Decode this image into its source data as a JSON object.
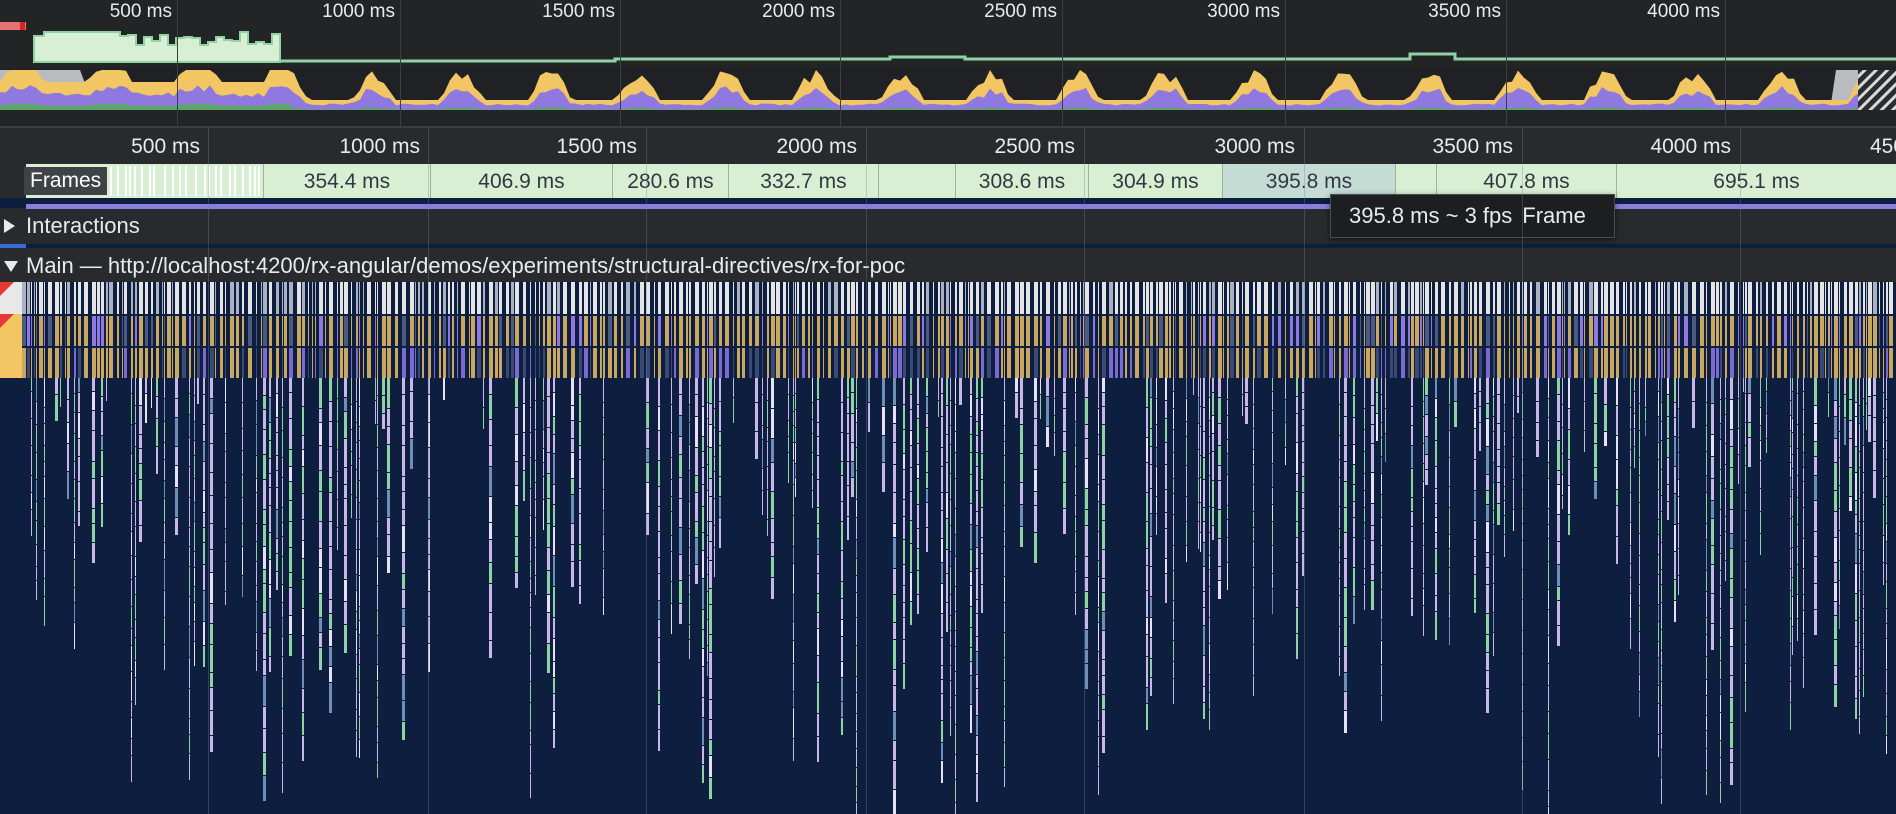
{
  "overview": {
    "ticks": [
      "500 ms",
      "1000 ms",
      "1500 ms",
      "2000 ms",
      "2500 ms",
      "3000 ms",
      "3500 ms",
      "4000 ms"
    ]
  },
  "timeline": {
    "ticks": [
      "500 ms",
      "1000 ms",
      "1500 ms",
      "2000 ms",
      "2500 ms",
      "3000 ms",
      "3500 ms",
      "4000 ms",
      "450"
    ]
  },
  "frames": {
    "label": "Frames",
    "durations": [
      "354.4 ms",
      "406.9 ms",
      "280.6 ms",
      "332.7 ms",
      "",
      "308.6 ms",
      "304.9 ms",
      "395.8 ms",
      "",
      "407.8 ms",
      "695.1 ms"
    ],
    "selected_index": 7
  },
  "tracks": {
    "interactions_label": "Interactions",
    "main_label": "Main — http://localhost:4200/rx-angular/demos/experiments/structural-directives/rx-for-poc"
  },
  "tooltip": {
    "duration": "395.8 ms ~ 3 fps",
    "type": "Frame"
  },
  "colors": {
    "flame_background": "#0d1e3e",
    "scripting": "#f2c662",
    "rendering": "#a48ee8",
    "painting": "#8fd3a4",
    "frame_green": "#d9efd4",
    "selection_blue": "#3a6ad6"
  }
}
